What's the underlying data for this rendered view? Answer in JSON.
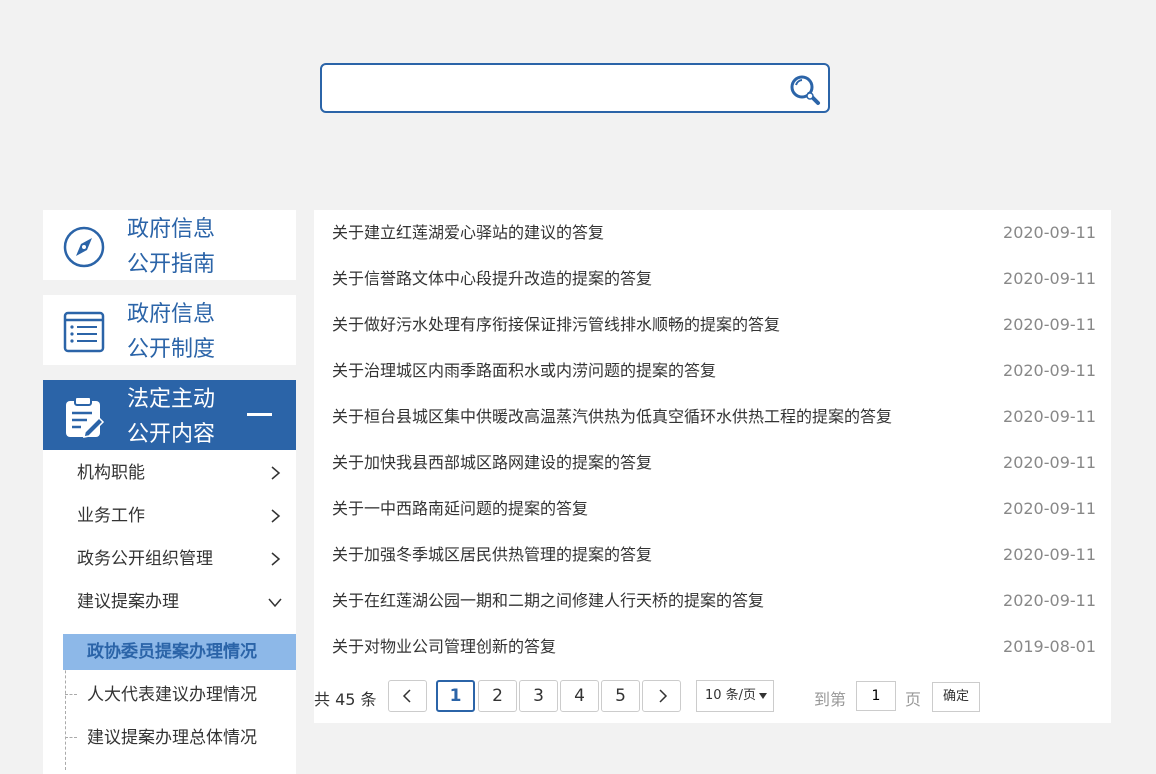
{
  "search": {
    "placeholder": "",
    "value": ""
  },
  "sidebar": {
    "cards": [
      {
        "line1": "政府信息",
        "line2": "公开指南",
        "icon": "compass-icon"
      },
      {
        "line1": "政府信息",
        "line2": "公开制度",
        "icon": "document-list-icon"
      },
      {
        "line1": "法定主动",
        "line2": "公开内容",
        "icon": "clipboard-edit-icon",
        "expanded": true
      }
    ],
    "sub_items": [
      {
        "label": "机构职能",
        "expanded": false
      },
      {
        "label": "业务工作",
        "expanded": false
      },
      {
        "label": "政务公开组织管理",
        "expanded": false
      },
      {
        "label": "建议提案办理",
        "expanded": true
      }
    ],
    "leaves": [
      {
        "label": "政协委员提案办理情况",
        "active": true
      },
      {
        "label": "人大代表建议办理情况",
        "active": false
      },
      {
        "label": "建议提案办理总体情况",
        "active": false
      }
    ]
  },
  "list": {
    "rows": [
      {
        "title": "关于建立红莲湖爱心驿站的建议的答复",
        "date": "2020-09-11"
      },
      {
        "title": "关于信誉路文体中心段提升改造的提案的答复",
        "date": "2020-09-11"
      },
      {
        "title": "关于做好污水处理有序衔接保证排污管线排水顺畅的提案的答复",
        "date": "2020-09-11"
      },
      {
        "title": "关于治理城区内雨季路面积水或内涝问题的提案的答复",
        "date": "2020-09-11"
      },
      {
        "title": "关于桓台县城区集中供暖改高温蒸汽供热为低真空循环水供热工程的提案的答复",
        "date": "2020-09-11"
      },
      {
        "title": "关于加快我县西部城区路网建设的提案的答复",
        "date": "2020-09-11"
      },
      {
        "title": "关于一中西路南延问题的提案的答复",
        "date": "2020-09-11"
      },
      {
        "title": "关于加强冬季城区居民供热管理的提案的答复",
        "date": "2020-09-11"
      },
      {
        "title": "关于在红莲湖公园一期和二期之间修建人行天桥的提案的答复",
        "date": "2020-09-11"
      },
      {
        "title": "关于对物业公司管理创新的答复",
        "date": "2019-08-01"
      }
    ]
  },
  "pagination": {
    "total_text": "共 45 条",
    "prev": "<",
    "next": ">",
    "pages": [
      "1",
      "2",
      "3",
      "4",
      "5"
    ],
    "current": "1",
    "per_page": "10 条/页",
    "goto_label": "到第",
    "goto_value": "1",
    "page_unit": "页",
    "confirm": "确定"
  },
  "colors": {
    "primary": "#2b64a8",
    "active_bg": "#8db8e8",
    "page_bg": "#f2f2f2"
  }
}
